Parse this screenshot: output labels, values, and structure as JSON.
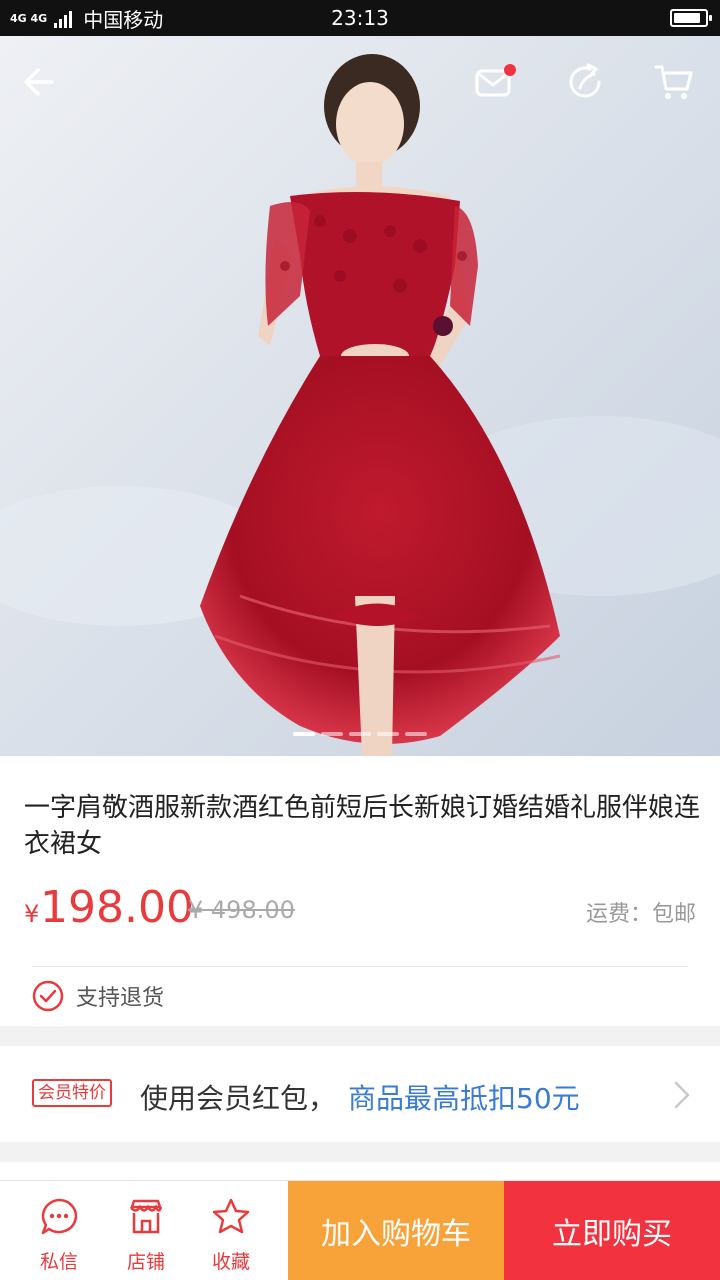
{
  "status_bar": {
    "network": "4G 4G",
    "carrier": "中国移动",
    "time": "23:13",
    "battery_level": 0.85
  },
  "hero": {
    "image_count": 5,
    "active_index": 0
  },
  "product": {
    "title": "一字肩敬酒服新款酒红色前短后长新娘订婚结婚礼服伴娘连衣裙女",
    "currency": "¥",
    "price": "198.00",
    "original_price": "¥ 498.00",
    "shipping": "运费：包邮",
    "returns_label": "支持退货"
  },
  "member": {
    "badge": "会员特价",
    "text": "使用会员红包，",
    "highlight": "商品最高抵扣50元"
  },
  "bottom_bar": {
    "message_label": "私信",
    "store_label": "店铺",
    "favorite_label": "收藏",
    "add_cart_label": "加入购物车",
    "buy_now_label": "立即购买"
  },
  "colors": {
    "accent_red": "#e93a3c",
    "link_blue": "#3a7bd5",
    "cart_orange": "#f8a33a",
    "buy_red": "#f2333f"
  },
  "icons": [
    "back-arrow-icon",
    "mail-icon",
    "share-icon",
    "cart-icon",
    "check-circle-icon",
    "chevron-right-icon",
    "chat-icon",
    "store-icon",
    "star-icon"
  ]
}
